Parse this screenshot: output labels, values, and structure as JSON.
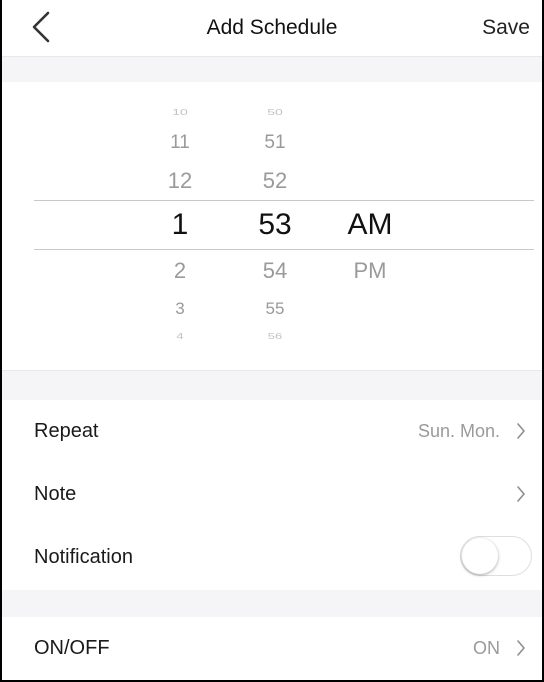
{
  "header": {
    "title": "Add Schedule",
    "save_label": "Save",
    "back_icon": "chevron-left-icon"
  },
  "time_picker": {
    "hours": {
      "above": [
        "10",
        "11",
        "12"
      ],
      "selected": "1",
      "below": [
        "2",
        "3",
        "4"
      ]
    },
    "minutes": {
      "above": [
        "50",
        "51",
        "52"
      ],
      "selected": "53",
      "below": [
        "54",
        "55",
        "56"
      ]
    },
    "meridiem": {
      "selected": "AM",
      "below": [
        "PM"
      ]
    }
  },
  "settings": {
    "repeat": {
      "label": "Repeat",
      "value": "Sun. Mon."
    },
    "note": {
      "label": "Note",
      "value": ""
    },
    "notification": {
      "label": "Notification",
      "enabled": false
    },
    "onoff": {
      "label": "ON/OFF",
      "value": "ON"
    }
  },
  "colors": {
    "background": "#ffffff",
    "section_gap": "#f5f5f7",
    "muted_text": "#9a9a9a",
    "primary_text": "#1a1a1a"
  }
}
